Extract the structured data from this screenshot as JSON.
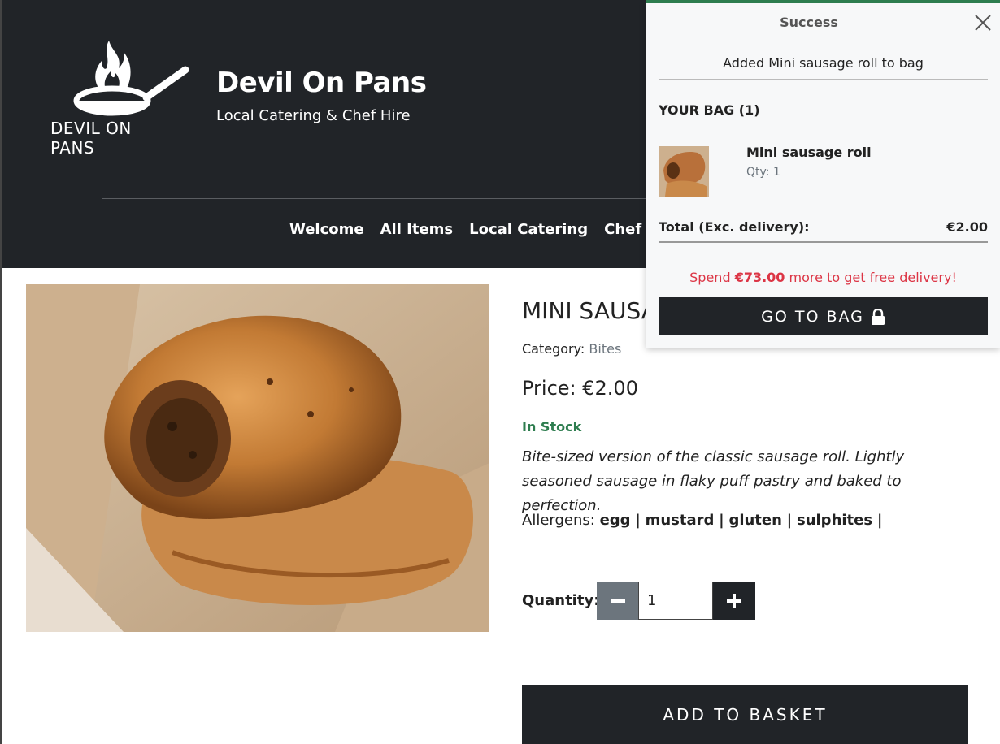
{
  "brand": {
    "logo_text": "DEVIL ON PANS",
    "title": "Devil On Pans",
    "tagline": "Local Catering & Chef Hire"
  },
  "nav": {
    "items": [
      {
        "label": "Welcome"
      },
      {
        "label": "All Items"
      },
      {
        "label": "Local Catering"
      },
      {
        "label": "Chef Hire"
      }
    ]
  },
  "product": {
    "title": "MINI SAUSA",
    "category_label": "Category:",
    "category_value": "Bites",
    "price": "Price: €2.00",
    "stock": "In Stock",
    "description": "Bite-sized version of the classic sausage roll. Lightly seasoned sausage in flaky puff pastry and baked to perfection.",
    "allergens_label": "Allergens:",
    "allergens": [
      "egg",
      "mustard",
      "gluten",
      "sulphites"
    ],
    "quantity_label": "Quantity:",
    "quantity_value": "1",
    "add_button": "ADD TO BASKET"
  },
  "toast": {
    "title": "Success",
    "message": "Added Mini sausage roll to bag",
    "bag_heading": "YOUR BAG (1)",
    "item_name": "Mini sausage roll",
    "item_qty": "Qty: 1",
    "total_label": "Total (Exc. delivery):",
    "total_value": "€2.00",
    "delivery_prefix": "Spend ",
    "delivery_amount": "€73.00",
    "delivery_suffix": " more to get free delivery!",
    "go_bag_label": "GO TO BAG"
  },
  "colors": {
    "header_bg": "#212428",
    "success_green": "#2e7d4f",
    "alert_red": "#dc3545",
    "muted_grey": "#6c757d"
  }
}
